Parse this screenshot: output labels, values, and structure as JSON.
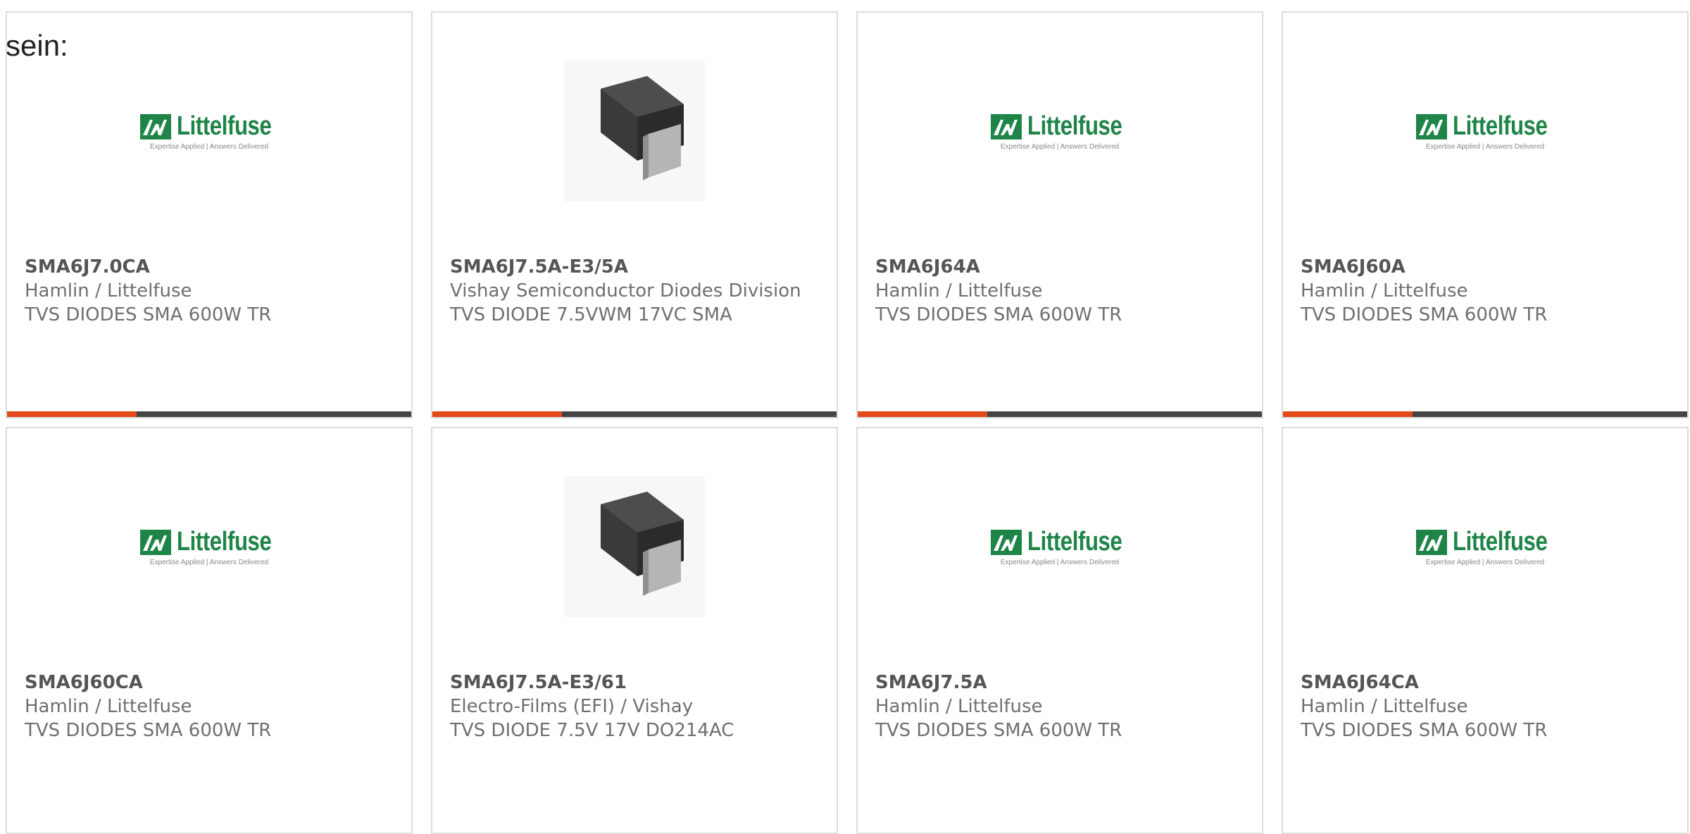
{
  "intro_text": "sein:",
  "colors": {
    "accent": "#e24a1a",
    "bar_track": "#444444",
    "logo_green": "#1e8447",
    "card_border": "#dcdcdc"
  },
  "products": [
    {
      "part_number": "SMA6J7.0CA",
      "manufacturer": "Hamlin / Littelfuse",
      "description": "TVS DIODES SMA 600W TR",
      "image": "littelfuse-logo",
      "progress": 0.32
    },
    {
      "part_number": "SMA6J7.5A-E3/5A",
      "manufacturer": "Vishay Semiconductor Diodes Division",
      "description": "TVS DIODE 7.5VWM 17VC SMA",
      "image": "diode-package",
      "progress": 0.32
    },
    {
      "part_number": "SMA6J64A",
      "manufacturer": "Hamlin / Littelfuse",
      "description": "TVS DIODES SMA 600W TR",
      "image": "littelfuse-logo",
      "progress": 0.32
    },
    {
      "part_number": "SMA6J60A",
      "manufacturer": "Hamlin / Littelfuse",
      "description": "TVS DIODES SMA 600W TR",
      "image": "littelfuse-logo",
      "progress": 0.32
    },
    {
      "part_number": "SMA6J60CA",
      "manufacturer": "Hamlin / Littelfuse",
      "description": "TVS DIODES SMA 600W TR",
      "image": "littelfuse-logo",
      "progress": null
    },
    {
      "part_number": "SMA6J7.5A-E3/61",
      "manufacturer": "Electro-Films (EFI) / Vishay",
      "description": "TVS DIODE 7.5V 17V DO214AC",
      "image": "diode-package",
      "progress": null
    },
    {
      "part_number": "SMA6J7.5A",
      "manufacturer": "Hamlin / Littelfuse",
      "description": "TVS DIODES SMA 600W TR",
      "image": "littelfuse-logo",
      "progress": null
    },
    {
      "part_number": "SMA6J64CA",
      "manufacturer": "Hamlin / Littelfuse",
      "description": "TVS DIODES SMA 600W TR",
      "image": "littelfuse-logo",
      "progress": null
    }
  ],
  "logo": {
    "name": "Littelfuse",
    "tagline": "Expertise Applied  |  Answers Delivered"
  }
}
